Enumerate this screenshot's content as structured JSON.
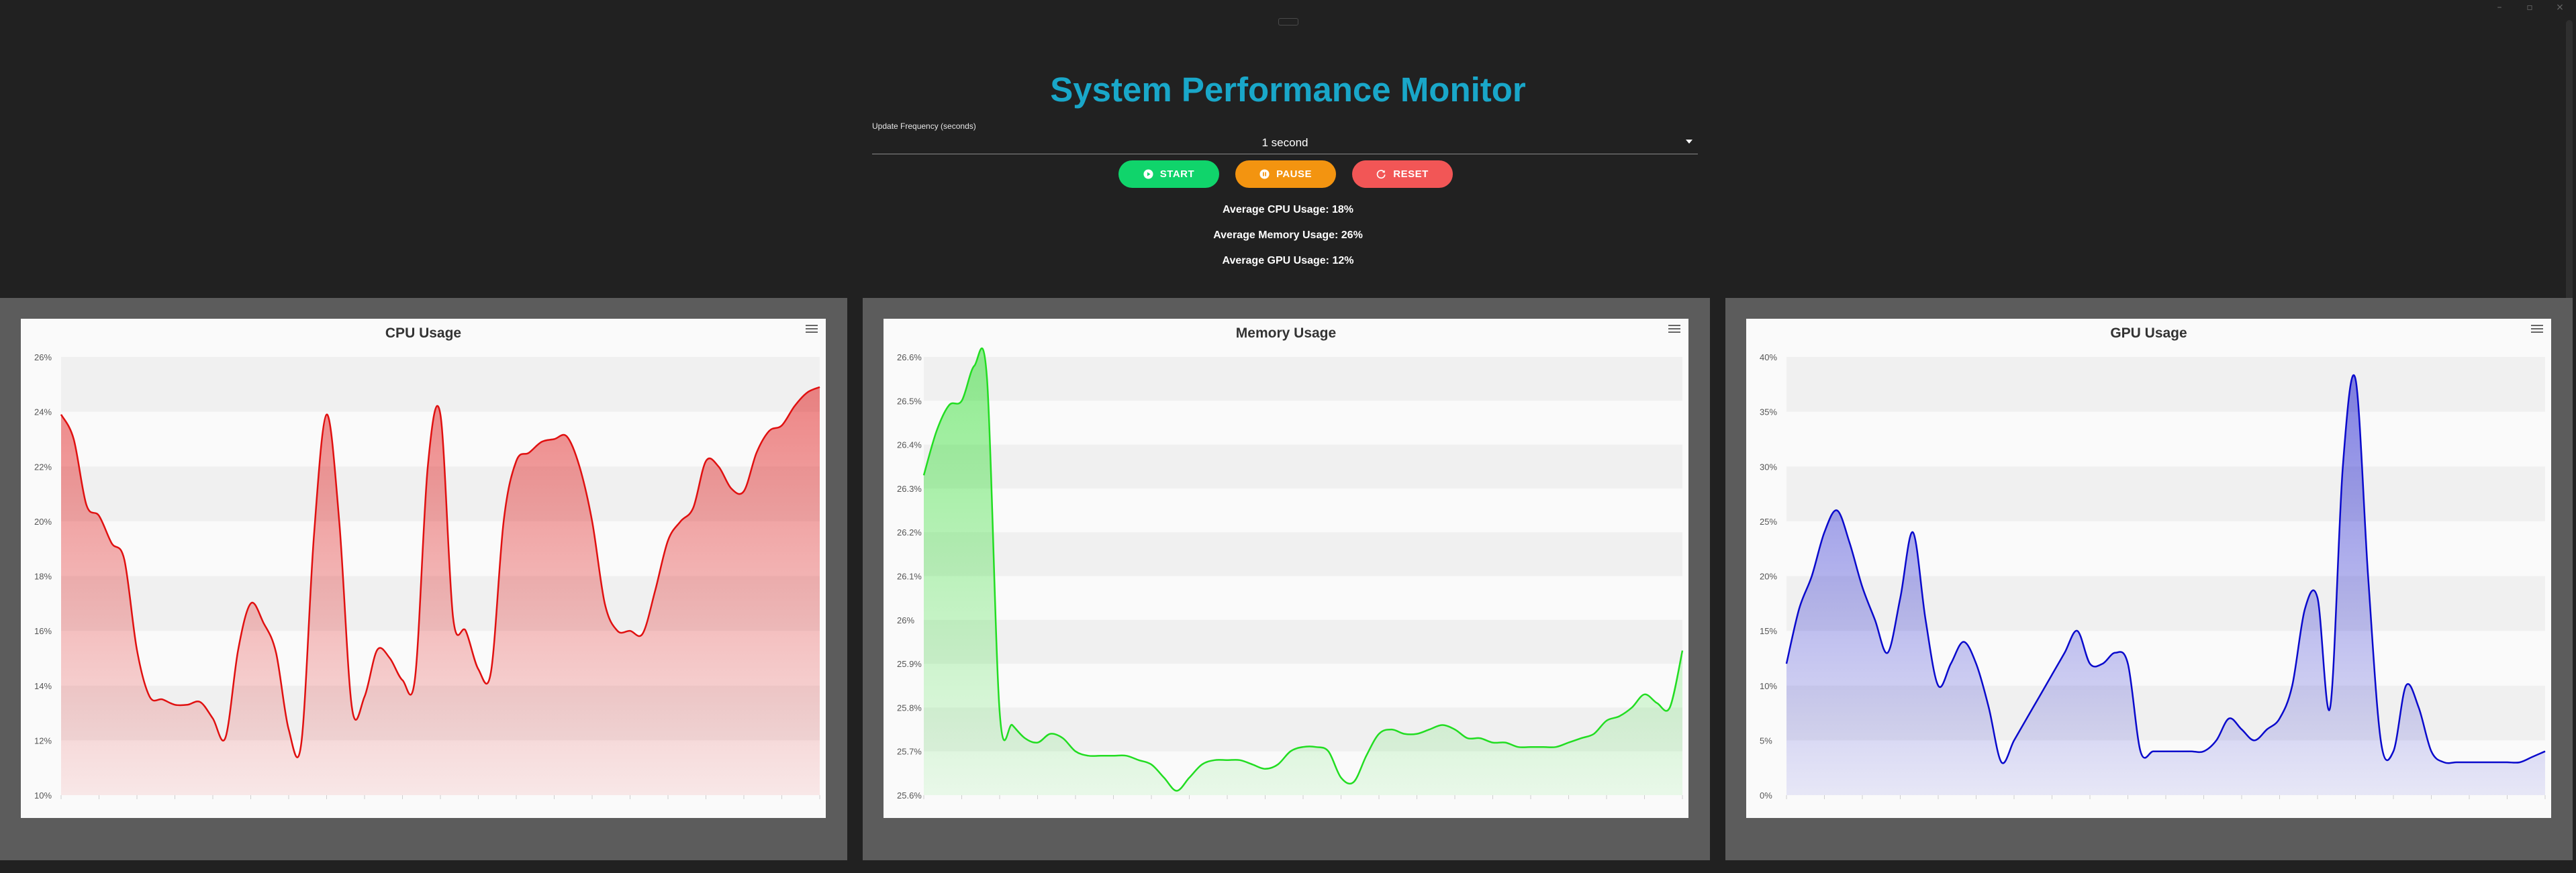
{
  "app": {
    "title": "System Performance Monitor"
  },
  "controls": {
    "frequency_label": "Update Frequency (seconds)",
    "frequency_value": "1 second",
    "start_label": "START",
    "pause_label": "PAUSE",
    "reset_label": "RESET"
  },
  "stats": {
    "cpu": "Average CPU Usage: 18%",
    "memory": "Average Memory Usage: 26%",
    "gpu": "Average GPU Usage: 12%"
  },
  "colors": {
    "accent": "#19a7c9",
    "start": "#10d46b",
    "pause": "#f39410",
    "reset": "#f25656",
    "cpu": "#e01010",
    "memory": "#22dd22",
    "gpu": "#0a0acc"
  },
  "icons": {
    "start": "play-circle-icon",
    "pause": "pause-circle-icon",
    "reset": "refresh-icon",
    "chart_menu": "hamburger-menu-icon"
  },
  "chart_data": [
    {
      "id": "cpu",
      "type": "area",
      "title": "CPU Usage",
      "color": "#e01010",
      "ylim": [
        10,
        26
      ],
      "yticks": [
        10,
        12,
        14,
        16,
        18,
        20,
        22,
        24,
        26
      ],
      "ytick_labels": [
        "10%",
        "12%",
        "14%",
        "16%",
        "18%",
        "20%",
        "22%",
        "24%",
        "26%"
      ],
      "grid": true,
      "x": [
        0,
        1,
        2,
        3,
        4,
        5,
        6,
        7,
        8,
        9,
        10,
        11,
        12,
        13,
        14,
        15,
        16,
        17,
        18,
        19,
        20,
        21,
        22,
        23,
        24,
        25,
        26,
        27,
        28,
        29,
        30,
        31,
        32,
        33,
        34,
        35,
        36,
        37,
        38,
        39,
        40,
        41,
        42,
        43,
        44,
        45,
        46,
        47,
        48,
        49,
        50,
        51,
        52,
        53,
        54,
        55,
        56,
        57,
        58,
        59,
        60
      ],
      "series": [
        {
          "values": [
            23.9,
            23.0,
            20.6,
            20.2,
            19.2,
            18.6,
            15.3,
            13.6,
            13.5,
            13.3,
            13.3,
            13.4,
            12.8,
            12.1,
            15.3,
            17.0,
            16.3,
            15.2,
            12.4,
            11.9,
            19.5,
            23.9,
            20.0,
            13.2,
            13.6,
            15.3,
            15.0,
            14.2,
            14.3,
            22.0,
            23.9,
            16.5,
            16.0,
            14.6,
            14.5,
            20.0,
            22.2,
            22.5,
            22.9,
            23.0,
            23.1,
            22.0,
            20.0,
            17.0,
            16.0,
            16.0,
            15.9,
            17.5,
            19.3,
            20.0,
            20.5,
            22.2,
            22.0,
            21.2,
            21.1,
            22.5,
            23.3,
            23.5,
            24.2,
            24.7,
            24.9
          ]
        }
      ]
    },
    {
      "id": "memory",
      "type": "area",
      "title": "Memory Usage",
      "color": "#22dd22",
      "ylim": [
        25.6,
        26.6
      ],
      "yticks": [
        25.6,
        25.7,
        25.8,
        25.9,
        26.0,
        26.1,
        26.2,
        26.3,
        26.4,
        26.5,
        26.6
      ],
      "ytick_labels": [
        "25.6%",
        "25.7%",
        "25.8%",
        "25.9%",
        "26%",
        "26.1%",
        "26.2%",
        "26.3%",
        "26.4%",
        "26.5%",
        "26.6%"
      ],
      "grid": true,
      "x": [
        0,
        1,
        2,
        3,
        4,
        5,
        6,
        7,
        8,
        9,
        10,
        11,
        12,
        13,
        14,
        15,
        16,
        17,
        18,
        19,
        20,
        21,
        22,
        23,
        24,
        25,
        26,
        27,
        28,
        29,
        30,
        31,
        32,
        33,
        34,
        35,
        36,
        37,
        38,
        39,
        40,
        41,
        42,
        43,
        44,
        45,
        46,
        47,
        48,
        49,
        50,
        51,
        52,
        53,
        54,
        55,
        56,
        57,
        58,
        59,
        60
      ],
      "series": [
        {
          "values": [
            26.33,
            26.43,
            26.49,
            26.5,
            26.58,
            26.55,
            25.79,
            25.76,
            25.73,
            25.72,
            25.74,
            25.73,
            25.7,
            25.69,
            25.69,
            25.69,
            25.69,
            25.68,
            25.67,
            25.64,
            25.61,
            25.64,
            25.67,
            25.68,
            25.68,
            25.68,
            25.67,
            25.66,
            25.67,
            25.7,
            25.71,
            25.71,
            25.7,
            25.64,
            25.63,
            25.69,
            25.74,
            25.75,
            25.74,
            25.74,
            25.75,
            25.76,
            25.75,
            25.73,
            25.73,
            25.72,
            25.72,
            25.71,
            25.71,
            25.71,
            25.71,
            25.72,
            25.73,
            25.74,
            25.77,
            25.78,
            25.8,
            25.83,
            25.81,
            25.8,
            25.93
          ]
        }
      ]
    },
    {
      "id": "gpu",
      "type": "area",
      "title": "GPU Usage",
      "color": "#0a0acc",
      "ylim": [
        0,
        40
      ],
      "yticks": [
        0,
        5,
        10,
        15,
        20,
        25,
        30,
        35,
        40
      ],
      "ytick_labels": [
        "0%",
        "5%",
        "10%",
        "15%",
        "20%",
        "25%",
        "30%",
        "35%",
        "40%"
      ],
      "grid": true,
      "x": [
        0,
        1,
        2,
        3,
        4,
        5,
        6,
        7,
        8,
        9,
        10,
        11,
        12,
        13,
        14,
        15,
        16,
        17,
        18,
        19,
        20,
        21,
        22,
        23,
        24,
        25,
        26,
        27,
        28,
        29,
        30,
        31,
        32,
        33,
        34,
        35,
        36,
        37,
        38,
        39,
        40,
        41,
        42,
        43,
        44,
        45,
        46,
        47,
        48,
        49,
        50,
        51,
        52,
        53,
        54,
        55,
        56,
        57,
        58,
        59,
        60
      ],
      "series": [
        {
          "values": [
            12,
            17,
            20,
            24,
            26,
            23,
            19,
            16,
            13,
            18,
            24,
            16,
            10,
            12,
            14,
            12,
            8,
            3,
            5,
            7,
            9,
            11,
            13,
            15,
            12,
            12,
            13,
            12,
            4,
            4,
            4,
            4,
            4,
            4,
            5,
            7,
            6,
            5,
            6,
            7,
            10,
            17,
            18,
            8,
            30,
            38,
            20,
            5,
            4,
            10,
            8,
            4,
            3,
            3,
            3,
            3,
            3,
            3,
            3,
            3.5,
            4
          ]
        }
      ]
    }
  ]
}
